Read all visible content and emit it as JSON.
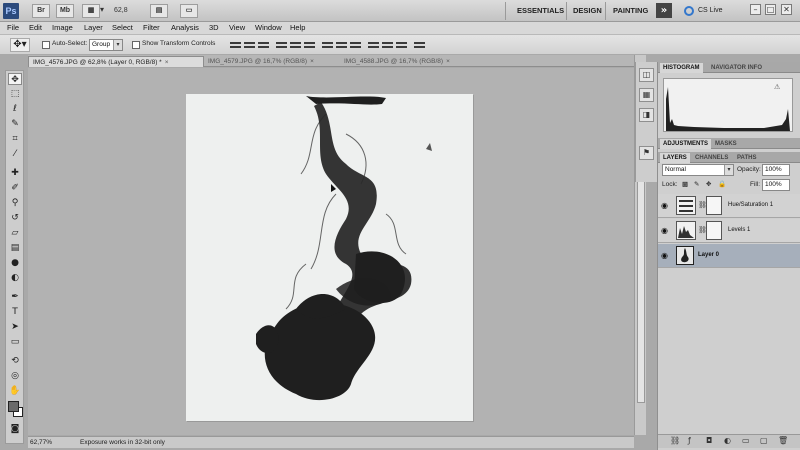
{
  "app": {
    "logo": "Ps",
    "bridge": "Br",
    "minibridge": "Mb",
    "zoom_display": "62,8",
    "workspaces": [
      "ESSENTIALS",
      "DESIGN",
      "PAINTING"
    ],
    "more_workspaces": "»",
    "cs_live": "CS Live",
    "window_controls": [
      "–",
      "□",
      "✕"
    ]
  },
  "menu": [
    "File",
    "Edit",
    "Image",
    "Layer",
    "Select",
    "Filter",
    "Analysis",
    "3D",
    "View",
    "Window",
    "Help"
  ],
  "options": {
    "auto_select_label": "Auto-Select:",
    "auto_select_value": "Group",
    "transform_label": "Show Transform Controls"
  },
  "tabs": [
    {
      "label": "IMG_4576.JPG @ 62,8% (Layer 0, RGB/8) *",
      "close": "×",
      "active": true
    },
    {
      "label": "IMG_4579.JPG @ 16,7% (RGB/8)",
      "close": "×",
      "active": false
    },
    {
      "label": "IMG_4588.JPG @ 16,7% (RGB/8)",
      "close": "×",
      "active": false
    }
  ],
  "status": {
    "zoom": "62,77%",
    "message": "Exposure works in 32-bit only"
  },
  "panels": {
    "top_tabs": [
      "HISTOGRAM",
      "NAVIGATOR INFO"
    ],
    "adj_tabs": [
      "ADJUSTMENTS",
      "MASKS"
    ],
    "layer_tabs": [
      "LAYERS",
      "CHANNELS",
      "PATHS"
    ],
    "blend_mode": "Normal",
    "opacity_label": "Opacity:",
    "opacity_value": "100%",
    "lock_label": "Lock:",
    "fill_label": "Fill:",
    "fill_value": "100%",
    "layers": [
      {
        "name": "Hue/Saturation 1",
        "type": "adjustment"
      },
      {
        "name": "Levels 1",
        "type": "adjustment"
      },
      {
        "name": "Layer 0",
        "type": "image",
        "selected": true
      }
    ]
  }
}
